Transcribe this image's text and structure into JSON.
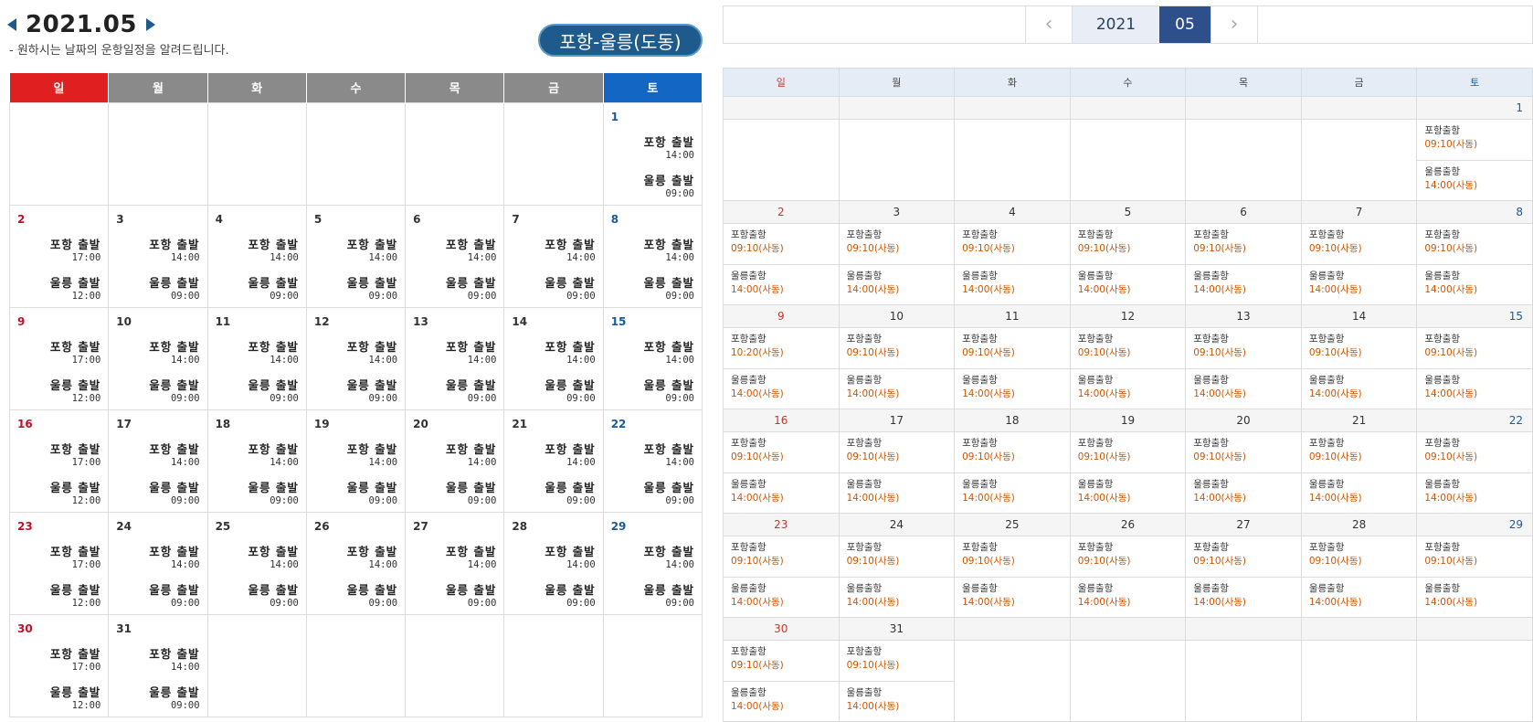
{
  "left": {
    "title": "2021.05",
    "subtitle": "- 원하시는 날짜의 운항일정을 알려드립니다.",
    "route": "포항-울릉(도동)",
    "weekdays": [
      "일",
      "월",
      "화",
      "수",
      "목",
      "금",
      "토"
    ],
    "weeks": [
      [
        null,
        null,
        null,
        null,
        null,
        null,
        {
          "d": "1",
          "e": [
            {
              "l": "포항 출발",
              "t": "14:00"
            },
            {
              "l": "울릉 출발",
              "t": "09:00"
            }
          ]
        }
      ],
      [
        {
          "d": "2",
          "e": [
            {
              "l": "포항 출발",
              "t": "17:00"
            },
            {
              "l": "울릉 출발",
              "t": "12:00"
            }
          ]
        },
        {
          "d": "3",
          "e": [
            {
              "l": "포항 출발",
              "t": "14:00"
            },
            {
              "l": "울릉 출발",
              "t": "09:00"
            }
          ]
        },
        {
          "d": "4",
          "e": [
            {
              "l": "포항 출발",
              "t": "14:00"
            },
            {
              "l": "울릉 출발",
              "t": "09:00"
            }
          ]
        },
        {
          "d": "5",
          "e": [
            {
              "l": "포항 출발",
              "t": "14:00"
            },
            {
              "l": "울릉 출발",
              "t": "09:00"
            }
          ]
        },
        {
          "d": "6",
          "e": [
            {
              "l": "포항 출발",
              "t": "14:00"
            },
            {
              "l": "울릉 출발",
              "t": "09:00"
            }
          ]
        },
        {
          "d": "7",
          "e": [
            {
              "l": "포항 출발",
              "t": "14:00"
            },
            {
              "l": "울릉 출발",
              "t": "09:00"
            }
          ]
        },
        {
          "d": "8",
          "e": [
            {
              "l": "포항 출발",
              "t": "14:00"
            },
            {
              "l": "울릉 출발",
              "t": "09:00"
            }
          ]
        }
      ],
      [
        {
          "d": "9",
          "e": [
            {
              "l": "포항 출발",
              "t": "17:00"
            },
            {
              "l": "울릉 출발",
              "t": "12:00"
            }
          ]
        },
        {
          "d": "10",
          "e": [
            {
              "l": "포항 출발",
              "t": "14:00"
            },
            {
              "l": "울릉 출발",
              "t": "09:00"
            }
          ]
        },
        {
          "d": "11",
          "e": [
            {
              "l": "포항 출발",
              "t": "14:00"
            },
            {
              "l": "울릉 출발",
              "t": "09:00"
            }
          ]
        },
        {
          "d": "12",
          "e": [
            {
              "l": "포항 출발",
              "t": "14:00"
            },
            {
              "l": "울릉 출발",
              "t": "09:00"
            }
          ]
        },
        {
          "d": "13",
          "e": [
            {
              "l": "포항 출발",
              "t": "14:00"
            },
            {
              "l": "울릉 출발",
              "t": "09:00"
            }
          ]
        },
        {
          "d": "14",
          "e": [
            {
              "l": "포항 출발",
              "t": "14:00"
            },
            {
              "l": "울릉 출발",
              "t": "09:00"
            }
          ]
        },
        {
          "d": "15",
          "e": [
            {
              "l": "포항 출발",
              "t": "14:00"
            },
            {
              "l": "울릉 출발",
              "t": "09:00"
            }
          ]
        }
      ],
      [
        {
          "d": "16",
          "e": [
            {
              "l": "포항 출발",
              "t": "17:00"
            },
            {
              "l": "울릉 출발",
              "t": "12:00"
            }
          ]
        },
        {
          "d": "17",
          "e": [
            {
              "l": "포항 출발",
              "t": "14:00"
            },
            {
              "l": "울릉 출발",
              "t": "09:00"
            }
          ]
        },
        {
          "d": "18",
          "e": [
            {
              "l": "포항 출발",
              "t": "14:00"
            },
            {
              "l": "울릉 출발",
              "t": "09:00"
            }
          ]
        },
        {
          "d": "19",
          "e": [
            {
              "l": "포항 출발",
              "t": "14:00"
            },
            {
              "l": "울릉 출발",
              "t": "09:00"
            }
          ]
        },
        {
          "d": "20",
          "e": [
            {
              "l": "포항 출발",
              "t": "14:00"
            },
            {
              "l": "울릉 출발",
              "t": "09:00"
            }
          ]
        },
        {
          "d": "21",
          "e": [
            {
              "l": "포항 출발",
              "t": "14:00"
            },
            {
              "l": "울릉 출발",
              "t": "09:00"
            }
          ]
        },
        {
          "d": "22",
          "e": [
            {
              "l": "포항 출발",
              "t": "14:00"
            },
            {
              "l": "울릉 출발",
              "t": "09:00"
            }
          ]
        }
      ],
      [
        {
          "d": "23",
          "e": [
            {
              "l": "포항 출발",
              "t": "17:00"
            },
            {
              "l": "울릉 출발",
              "t": "12:00"
            }
          ]
        },
        {
          "d": "24",
          "e": [
            {
              "l": "포항 출발",
              "t": "14:00"
            },
            {
              "l": "울릉 출발",
              "t": "09:00"
            }
          ]
        },
        {
          "d": "25",
          "e": [
            {
              "l": "포항 출발",
              "t": "14:00"
            },
            {
              "l": "울릉 출발",
              "t": "09:00"
            }
          ]
        },
        {
          "d": "26",
          "e": [
            {
              "l": "포항 출발",
              "t": "14:00"
            },
            {
              "l": "울릉 출발",
              "t": "09:00"
            }
          ]
        },
        {
          "d": "27",
          "e": [
            {
              "l": "포항 출발",
              "t": "14:00"
            },
            {
              "l": "울릉 출발",
              "t": "09:00"
            }
          ]
        },
        {
          "d": "28",
          "e": [
            {
              "l": "포항 출발",
              "t": "14:00"
            },
            {
              "l": "울릉 출발",
              "t": "09:00"
            }
          ]
        },
        {
          "d": "29",
          "e": [
            {
              "l": "포항 출발",
              "t": "14:00"
            },
            {
              "l": "울릉 출발",
              "t": "09:00"
            }
          ]
        }
      ],
      [
        {
          "d": "30",
          "e": [
            {
              "l": "포항 출발",
              "t": "17:00"
            },
            {
              "l": "울릉 출발",
              "t": "12:00"
            }
          ]
        },
        {
          "d": "31",
          "e": [
            {
              "l": "포항 출발",
              "t": "14:00"
            },
            {
              "l": "울릉 출발",
              "t": "09:00"
            }
          ]
        },
        null,
        null,
        null,
        null,
        null
      ]
    ]
  },
  "right": {
    "year": "2021",
    "month": "05",
    "prev_icon": "chevron-left-icon",
    "next_icon": "chevron-right-icon",
    "weekdays": [
      "일",
      "월",
      "화",
      "수",
      "목",
      "금",
      "토"
    ],
    "weeks": [
      [
        null,
        null,
        null,
        null,
        null,
        null,
        {
          "d": "1",
          "e": [
            {
              "l": "포항출항",
              "t": "09:10(사동)"
            },
            {
              "l": "울릉출항",
              "t": "14:00(사동)"
            }
          ]
        }
      ],
      [
        {
          "d": "2",
          "e": [
            {
              "l": "포항출항",
              "t": "09:10(사동)"
            },
            {
              "l": "울릉출항",
              "t": "14:00(사동)"
            }
          ]
        },
        {
          "d": "3",
          "e": [
            {
              "l": "포항출항",
              "t": "09:10(사동)"
            },
            {
              "l": "울릉출항",
              "t": "14:00(사동)"
            }
          ]
        },
        {
          "d": "4",
          "e": [
            {
              "l": "포항출항",
              "t": "09:10(사동)"
            },
            {
              "l": "울릉출항",
              "t": "14:00(사동)"
            }
          ]
        },
        {
          "d": "5",
          "e": [
            {
              "l": "포항출항",
              "t": "09:10(사동)"
            },
            {
              "l": "울릉출항",
              "t": "14:00(사동)"
            }
          ]
        },
        {
          "d": "6",
          "e": [
            {
              "l": "포항출항",
              "t": "09:10(사동)"
            },
            {
              "l": "울릉출항",
              "t": "14:00(사동)"
            }
          ]
        },
        {
          "d": "7",
          "e": [
            {
              "l": "포항출항",
              "t": "09:10(사동)"
            },
            {
              "l": "울릉출항",
              "t": "14:00(사동)"
            }
          ]
        },
        {
          "d": "8",
          "e": [
            {
              "l": "포항출항",
              "t": "09:10(사동)"
            },
            {
              "l": "울릉출항",
              "t": "14:00(사동)"
            }
          ]
        }
      ],
      [
        {
          "d": "9",
          "e": [
            {
              "l": "포항출항",
              "t": "10:20(사동)"
            },
            {
              "l": "울릉출항",
              "t": "14:00(사동)"
            }
          ]
        },
        {
          "d": "10",
          "e": [
            {
              "l": "포항출항",
              "t": "09:10(사동)"
            },
            {
              "l": "울릉출항",
              "t": "14:00(사동)"
            }
          ]
        },
        {
          "d": "11",
          "e": [
            {
              "l": "포항출항",
              "t": "09:10(사동)"
            },
            {
              "l": "울릉출항",
              "t": "14:00(사동)"
            }
          ]
        },
        {
          "d": "12",
          "e": [
            {
              "l": "포항출항",
              "t": "09:10(사동)"
            },
            {
              "l": "울릉출항",
              "t": "14:00(사동)"
            }
          ]
        },
        {
          "d": "13",
          "e": [
            {
              "l": "포항출항",
              "t": "09:10(사동)"
            },
            {
              "l": "울릉출항",
              "t": "14:00(사동)"
            }
          ]
        },
        {
          "d": "14",
          "e": [
            {
              "l": "포항출항",
              "t": "09:10(사동)"
            },
            {
              "l": "울릉출항",
              "t": "14:00(사동)"
            }
          ]
        },
        {
          "d": "15",
          "e": [
            {
              "l": "포항출항",
              "t": "09:10(사동)"
            },
            {
              "l": "울릉출항",
              "t": "14:00(사동)"
            }
          ]
        }
      ],
      [
        {
          "d": "16",
          "e": [
            {
              "l": "포항출항",
              "t": "09:10(사동)"
            },
            {
              "l": "울릉출항",
              "t": "14:00(사동)"
            }
          ]
        },
        {
          "d": "17",
          "e": [
            {
              "l": "포항출항",
              "t": "09:10(사동)"
            },
            {
              "l": "울릉출항",
              "t": "14:00(사동)"
            }
          ]
        },
        {
          "d": "18",
          "e": [
            {
              "l": "포항출항",
              "t": "09:10(사동)"
            },
            {
              "l": "울릉출항",
              "t": "14:00(사동)"
            }
          ]
        },
        {
          "d": "19",
          "e": [
            {
              "l": "포항출항",
              "t": "09:10(사동)"
            },
            {
              "l": "울릉출항",
              "t": "14:00(사동)"
            }
          ]
        },
        {
          "d": "20",
          "e": [
            {
              "l": "포항출항",
              "t": "09:10(사동)"
            },
            {
              "l": "울릉출항",
              "t": "14:00(사동)"
            }
          ]
        },
        {
          "d": "21",
          "e": [
            {
              "l": "포항출항",
              "t": "09:10(사동)"
            },
            {
              "l": "울릉출항",
              "t": "14:00(사동)"
            }
          ]
        },
        {
          "d": "22",
          "e": [
            {
              "l": "포항출항",
              "t": "09:10(사동)"
            },
            {
              "l": "울릉출항",
              "t": "14:00(사동)"
            }
          ]
        }
      ],
      [
        {
          "d": "23",
          "e": [
            {
              "l": "포항출항",
              "t": "09:10(사동)"
            },
            {
              "l": "울릉출항",
              "t": "14:00(사동)"
            }
          ]
        },
        {
          "d": "24",
          "e": [
            {
              "l": "포항출항",
              "t": "09:10(사동)"
            },
            {
              "l": "울릉출항",
              "t": "14:00(사동)"
            }
          ]
        },
        {
          "d": "25",
          "e": [
            {
              "l": "포항출항",
              "t": "09:10(사동)"
            },
            {
              "l": "울릉출항",
              "t": "14:00(사동)"
            }
          ]
        },
        {
          "d": "26",
          "e": [
            {
              "l": "포항출항",
              "t": "09:10(사동)"
            },
            {
              "l": "울릉출항",
              "t": "14:00(사동)"
            }
          ]
        },
        {
          "d": "27",
          "e": [
            {
              "l": "포항출항",
              "t": "09:10(사동)"
            },
            {
              "l": "울릉출항",
              "t": "14:00(사동)"
            }
          ]
        },
        {
          "d": "28",
          "e": [
            {
              "l": "포항출항",
              "t": "09:10(사동)"
            },
            {
              "l": "울릉출항",
              "t": "14:00(사동)"
            }
          ]
        },
        {
          "d": "29",
          "e": [
            {
              "l": "포항출항",
              "t": "09:10(사동)"
            },
            {
              "l": "울릉출항",
              "t": "14:00(사동)"
            }
          ]
        }
      ],
      [
        {
          "d": "30",
          "e": [
            {
              "l": "포항출항",
              "t": "09:10(사동)"
            },
            {
              "l": "울릉출항",
              "t": "14:00(사동)"
            }
          ]
        },
        {
          "d": "31",
          "e": [
            {
              "l": "포항출항",
              "t": "09:10(사동)"
            },
            {
              "l": "울릉출항",
              "t": "14:00(사동)"
            }
          ]
        },
        null,
        null,
        null,
        null,
        null
      ]
    ]
  }
}
